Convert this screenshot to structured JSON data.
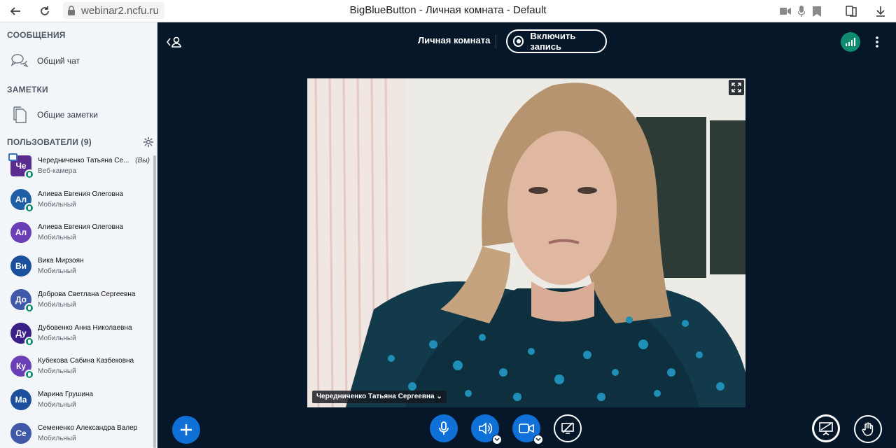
{
  "browser": {
    "url": "webinar2.ncfu.ru",
    "window_title": "BigBlueButton - Личная комната - Default"
  },
  "sidebar": {
    "messages_title": "СООБЩЕНИЯ",
    "public_chat_label": "Общий чат",
    "notes_title": "ЗАМЕТКИ",
    "shared_notes_label": "Общие заметки",
    "users_title": "ПОЛЬЗОВАТЕЛИ (9)",
    "users": [
      {
        "initials": "Че",
        "name": "Чередниченко Татьяна Се...",
        "you": "(Вы)",
        "status": "Веб-камера",
        "color": "#5b2c8f",
        "presenter": true,
        "mic": true
      },
      {
        "initials": "Ал",
        "name": "Алиева Евгения Олеговна",
        "status": "Мобильный",
        "color": "#1f5fa6",
        "mic": true
      },
      {
        "initials": "Ал",
        "name": "Алиева Евгения Олеговна",
        "status": "Мобильный",
        "color": "#6a3fb5",
        "mic": false
      },
      {
        "initials": "Ви",
        "name": "Вика Мирзоян",
        "status": "Мобильный",
        "color": "#1c4f9c",
        "mic": false
      },
      {
        "initials": "До",
        "name": "Доброва Светлана Сергеевна",
        "status": "Мобильный",
        "color": "#3f58a8",
        "mic": true
      },
      {
        "initials": "Ду",
        "name": "Дубовенко Анна Николаевна",
        "status": "Мобильный",
        "color": "#3a1f86",
        "mic": true
      },
      {
        "initials": "Ку",
        "name": "Кубекова Сабина Казбековна",
        "status": "Мобильный",
        "color": "#6a3fb5",
        "mic": true
      },
      {
        "initials": "Ма",
        "name": "Марина Грушина",
        "status": "Мобильный",
        "color": "#1c4f9c",
        "mic": false
      },
      {
        "initials": "Се",
        "name": "Семененко Александра Валер",
        "status": "Мобильный",
        "color": "#3f58a8",
        "mic": false
      }
    ]
  },
  "main": {
    "room_title": "Личная комната",
    "record_label": "Включить запись",
    "video_name": "Чередниченко Татьяна Сергеевна ⌄"
  },
  "colors": {
    "accent": "#0f70d7",
    "connection": "#0f8b6f",
    "background": "#06172a"
  }
}
